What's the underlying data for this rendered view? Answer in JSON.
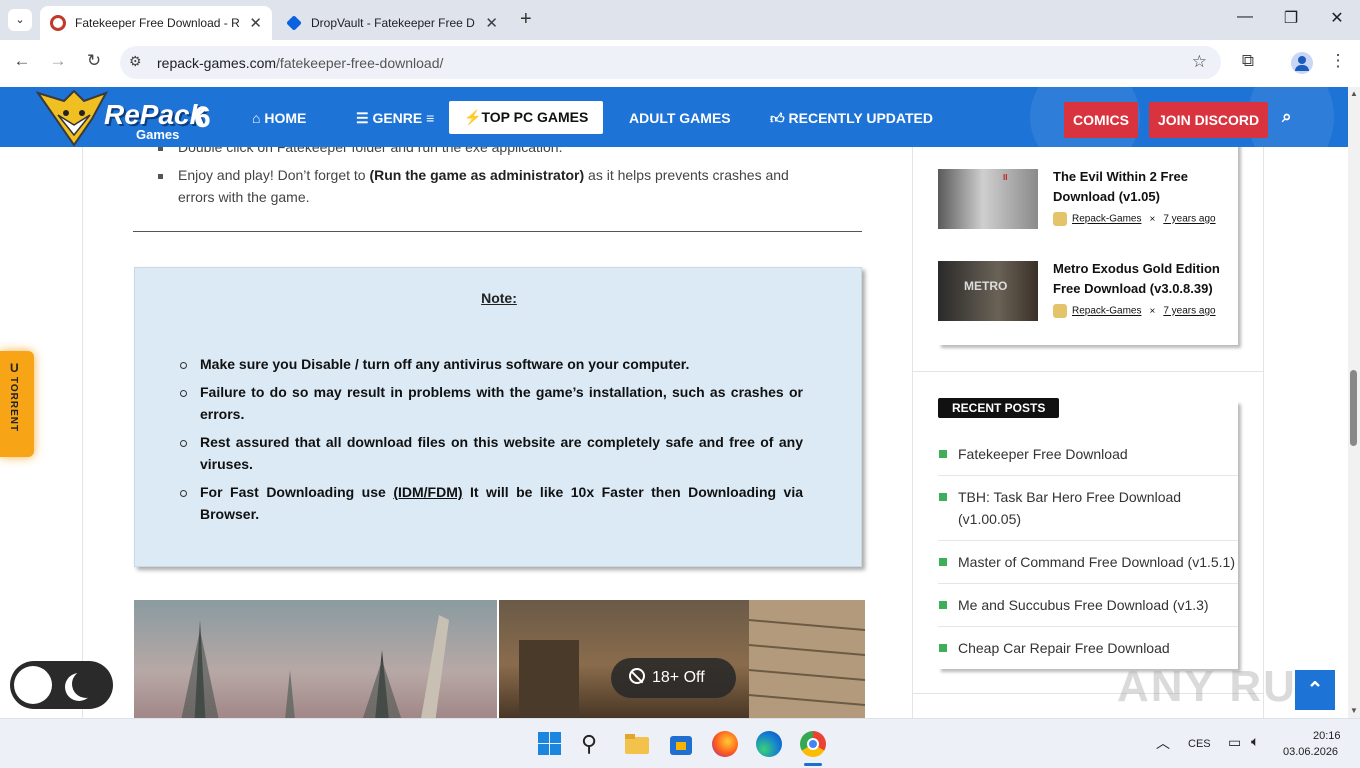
{
  "browser": {
    "tabs": [
      {
        "title": "Fatekeeper Free Download - Rep",
        "close": "✕",
        "active": true
      },
      {
        "title": "DropVault - Fatekeeper Free Dow",
        "close": "✕",
        "active": false
      }
    ],
    "new_tab": "+",
    "url_domain": "repack-games.com",
    "url_path": "/fatekeeper-free-download/"
  },
  "site": {
    "logo_text": "RePack",
    "logo_sub": "Games",
    "menu": [
      {
        "label": "HOME",
        "icon": "home-icon"
      },
      {
        "label": "GENRE",
        "icon": "list-icon"
      },
      {
        "label": "TOP PC GAMES",
        "icon": "rocket-icon",
        "selected": true
      },
      {
        "label": "ADULT GAMES"
      },
      {
        "label": "RECENTLY UPDATED",
        "icon": "thumbs-up-icon"
      }
    ],
    "comics": "COMICS",
    "discord": "JOIN DISCORD",
    "accent": "#1d73d6",
    "button_red": "#d9333f"
  },
  "article": {
    "bullet1": "Double click on Fatekeeper folder and run the exe application.",
    "bullet2_pre": "Enjoy and play! Don’t forget to ",
    "bullet2_bold": "(Run the game as administrator)",
    "bullet2_post": " as it helps prevents crashes and errors with the game.",
    "note_title": "Note:",
    "note_items": [
      "Make sure you Disable / turn off any antivirus software on your computer.",
      "Failure to do so may result in problems with the game’s installation, such as crashes or errors.",
      "Rest assured that all download files on this website are completely safe and free of any viruses."
    ],
    "note_last_pre": "For Fast Downloading use ",
    "note_last_link": "(IDM/FDM)",
    "note_last_post": " It will be like 10x Faster then Downloading via Browser.",
    "adult_toggle": "18+ Off"
  },
  "sidebar": {
    "posts": [
      {
        "title": "The Evil Within 2 Free Download (v1.05)",
        "author": "Repack-Games",
        "sep": "×",
        "date": "7 years ago"
      },
      {
        "title": "Metro Exodus Gold Edition Free Download (v3.0.8.39)",
        "author": "Repack-Games",
        "sep": "×",
        "date": "7 years ago"
      }
    ],
    "recent_heading": "RECENT POSTS",
    "recent": [
      "Fatekeeper Free Download",
      "TBH: Task Bar Hero Free Download (v1.00.05)",
      "Master of Command Free Download (v1.5.1)",
      "Me and Succubus Free Download (v1.3)",
      "Cheap Car Repair Free Download"
    ]
  },
  "torrent_tab": "TORRENT",
  "watermark": "ANY RUN",
  "taskbar": {
    "lang": "CES",
    "time": "20:16",
    "date": "03.06.2026"
  }
}
